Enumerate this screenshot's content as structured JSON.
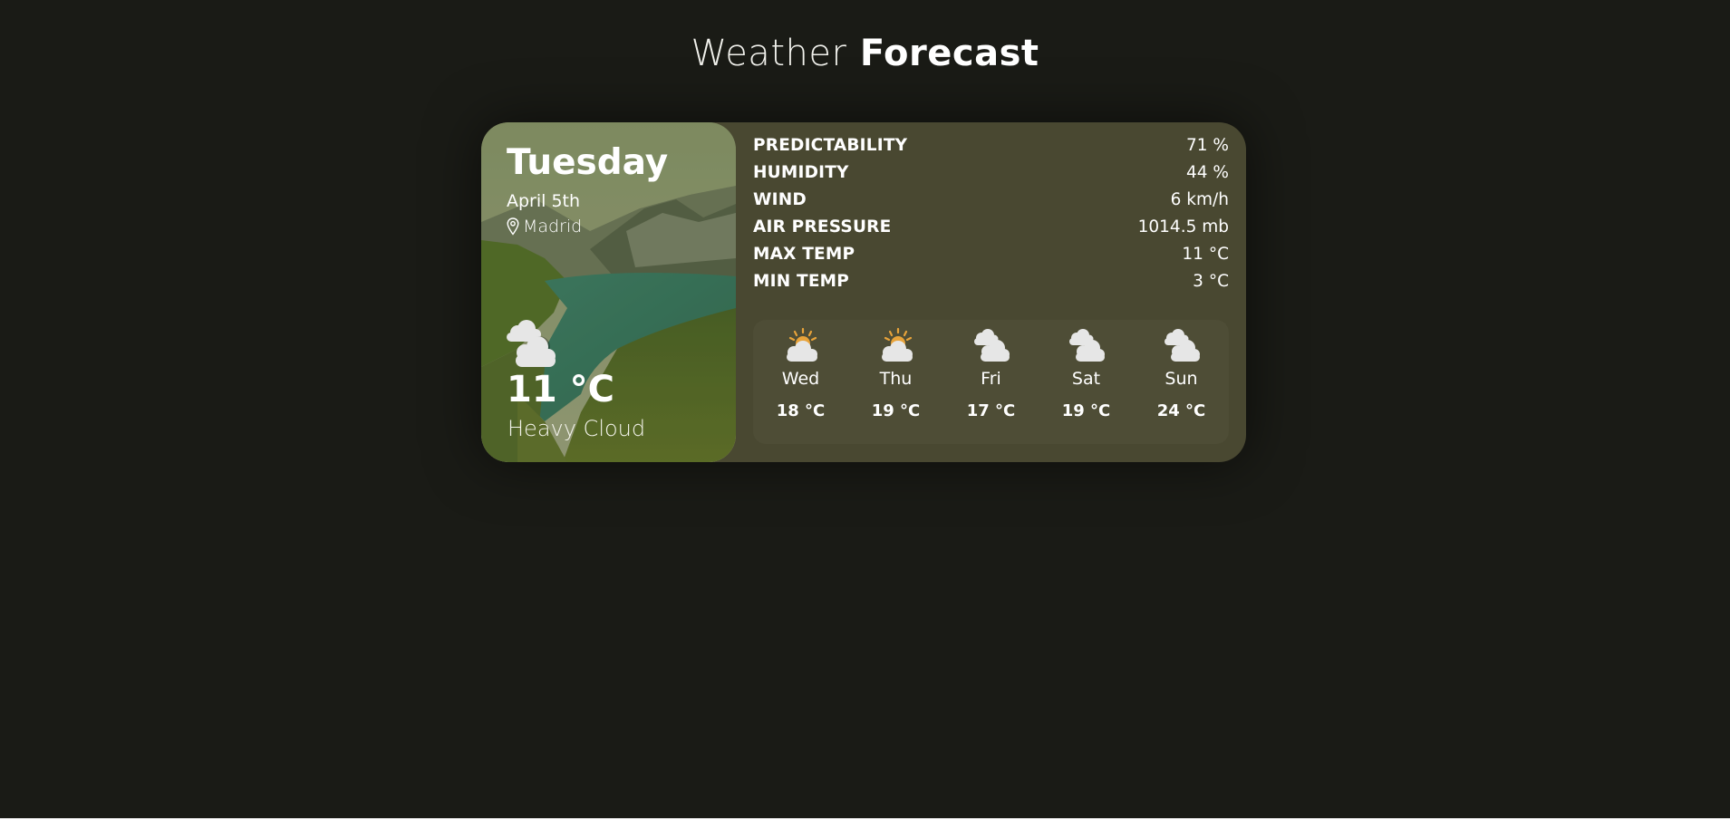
{
  "header": {
    "title_light": "Weather",
    "title_bold": "Forecast"
  },
  "today": {
    "day": "Tuesday",
    "date": "April 5th",
    "location": "Madrid",
    "location_icon": "map-pin-icon",
    "weather_icon": "heavy-cloud-icon",
    "temperature": "11 °C",
    "condition": "Heavy Cloud"
  },
  "stats": [
    {
      "label": "PREDICTABILITY",
      "value": "71 %"
    },
    {
      "label": "HUMIDITY",
      "value": "44 %"
    },
    {
      "label": "WIND",
      "value": "6 km/h"
    },
    {
      "label": "AIR PRESSURE",
      "value": "1014.5 mb"
    },
    {
      "label": "MAX TEMP",
      "value": "11 °C"
    },
    {
      "label": "MIN TEMP",
      "value": "3 °C"
    }
  ],
  "forecast": [
    {
      "day": "Wed",
      "temp": "18 °C",
      "icon": "partly-sunny-icon"
    },
    {
      "day": "Thu",
      "temp": "19 °C",
      "icon": "partly-sunny-icon"
    },
    {
      "day": "Fri",
      "temp": "17 °C",
      "icon": "heavy-cloud-icon"
    },
    {
      "day": "Sat",
      "temp": "19 °C",
      "icon": "heavy-cloud-icon"
    },
    {
      "day": "Sun",
      "temp": "24 °C",
      "icon": "heavy-cloud-icon"
    }
  ],
  "colors": {
    "background": "#1a1b16",
    "card": "#494831",
    "forecast_panel": "#4e4d36",
    "sun": "#e8a33a",
    "cloud": "#e6e6e6"
  }
}
